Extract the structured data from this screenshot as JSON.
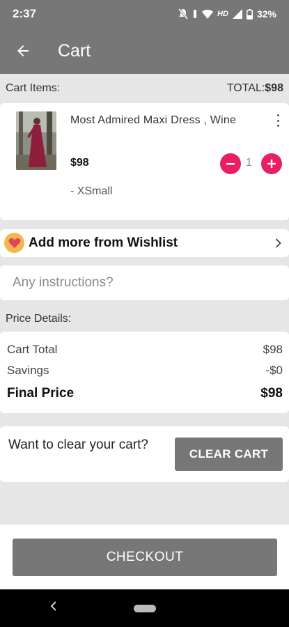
{
  "status_bar": {
    "time": "2:37",
    "network": "HD",
    "battery": "32%",
    "icons": [
      "mute-icon",
      "vibrate-icon",
      "wifi-icon",
      "signal-icon",
      "battery-icon"
    ]
  },
  "app_bar": {
    "title": "Cart",
    "back_icon": "arrow-left-icon"
  },
  "cart_header": {
    "label": "Cart Items:",
    "total_label": "TOTAL:",
    "total_value": "$98"
  },
  "cart_items": [
    {
      "name": "Most Admired Maxi Dress , Wine",
      "price": "$98",
      "quantity": "1",
      "variant": "- XSmall"
    }
  ],
  "wishlist": {
    "label": "Add more from Wishlist"
  },
  "instructions": {
    "placeholder": "Any instructions?"
  },
  "price_details": {
    "label": "Price Details:",
    "cart_total_label": "Cart Total",
    "cart_total_value": "$98",
    "savings_label": "Savings",
    "savings_value": "-$0",
    "final_label": "Final Price",
    "final_value": "$98"
  },
  "clear_cart": {
    "prompt": "Want to clear your cart?",
    "button_label": "CLEAR CART"
  },
  "checkout": {
    "button_label": "CHECKOUT"
  },
  "colors": {
    "primary_gray": "#777777",
    "accent_pink": "#e91e63",
    "background": "#e6e6e6"
  }
}
